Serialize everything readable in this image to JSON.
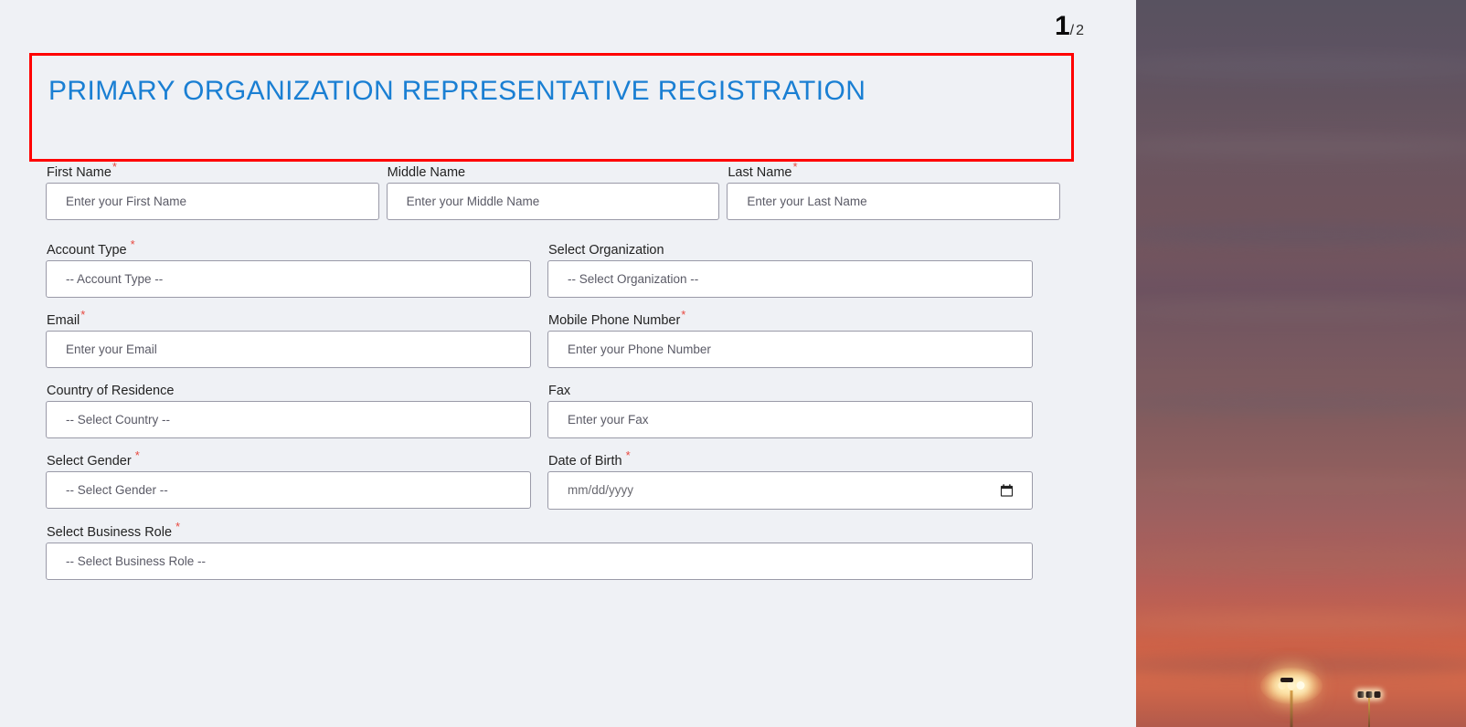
{
  "page_counter": {
    "current": "1",
    "separator": "/",
    "total": "2"
  },
  "header": {
    "title": "PRIMARY ORGANIZATION REPRESENTATIVE REGISTRATION",
    "highlight_color": "#ff0000",
    "title_color": "#1a7fd3"
  },
  "theme": {
    "background": "#eff1f5",
    "field_background": "#ffffff",
    "field_border": "#9a9aa8",
    "required_marker_color": "#e8483f",
    "label_color": "#232323",
    "placeholder_color": "#5a5a66"
  },
  "form": {
    "required_marker": "*",
    "rows": [
      {
        "fields": [
          {
            "label": "First Name",
            "required": true,
            "placeholder": "Enter your First Name",
            "type": "text",
            "name": "first-name"
          },
          {
            "label": "Middle Name",
            "required": false,
            "placeholder": "Enter your Middle Name",
            "type": "text",
            "name": "middle-name"
          },
          {
            "label": "Last Name",
            "required": true,
            "placeholder": "Enter your Last Name",
            "type": "text",
            "name": "last-name"
          }
        ]
      },
      {
        "fields": [
          {
            "label": "Account Type",
            "required": true,
            "placeholder": "-- Account Type --",
            "type": "select",
            "name": "account-type"
          },
          {
            "label": "Select Organization",
            "required": false,
            "placeholder": "-- Select Organization --",
            "type": "select",
            "name": "select-organization"
          }
        ]
      },
      {
        "fields": [
          {
            "label": "Email",
            "required": true,
            "placeholder": "Enter your Email",
            "type": "email",
            "name": "email"
          },
          {
            "label": "Mobile Phone Number",
            "required": true,
            "placeholder": "Enter your Phone Number",
            "type": "tel",
            "name": "mobile-phone-number"
          }
        ]
      },
      {
        "fields": [
          {
            "label": "Country of Residence",
            "required": false,
            "placeholder": "-- Select Country --",
            "type": "select",
            "name": "country-of-residence"
          },
          {
            "label": "Fax",
            "required": false,
            "placeholder": "Enter your Fax",
            "type": "text",
            "name": "fax"
          }
        ]
      },
      {
        "fields": [
          {
            "label": "Select Gender",
            "required": true,
            "placeholder": "-- Select Gender --",
            "type": "select",
            "name": "select-gender"
          },
          {
            "label": "Date of Birth",
            "required": true,
            "placeholder": "mm/dd/yyyy",
            "type": "date",
            "name": "date-of-birth"
          }
        ]
      },
      {
        "fields": [
          {
            "label": "Select Business Role",
            "required": true,
            "placeholder": "-- Select Business Role --",
            "type": "select",
            "name": "select-business-role"
          }
        ]
      }
    ]
  },
  "photo": {
    "description": "Sunset sky with stadium floodlights",
    "sky_top_color": "#585260",
    "sky_bottom_color": "#cf6247"
  }
}
